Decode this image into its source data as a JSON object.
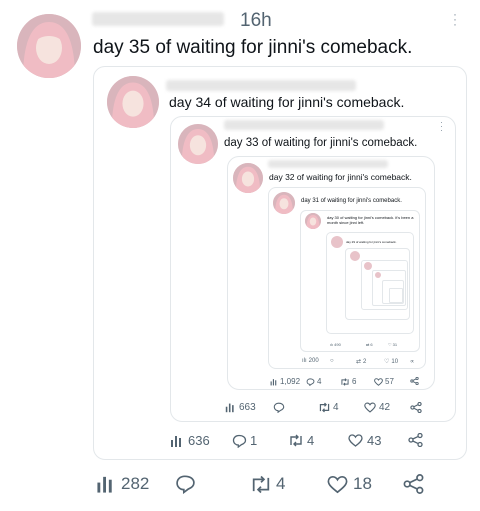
{
  "colors": {
    "text": "#0f1419",
    "muted": "#536471",
    "border": "#e3e7ea",
    "avatar_hair": "#f0bcc4",
    "avatar_skin": "#f6e3de"
  },
  "post": {
    "time": "16h",
    "text": "day 35 of waiting for jinni's comeback.",
    "actions": {
      "views": "282",
      "reposts": "4",
      "likes": "18"
    }
  },
  "quote1": {
    "text": "day 34 of waiting for jinni's comeback.",
    "actions": {
      "views": "636",
      "replies": "1",
      "reposts": "4",
      "likes": "43"
    }
  },
  "quote2": {
    "text": "day 33 of waiting for jinni's comeback.",
    "actions": {
      "views": "663",
      "reposts": "4",
      "likes": "42"
    }
  },
  "quote3": {
    "text": "day 32 of waiting for jinni's comeback.",
    "actions": {
      "views": "1,092",
      "replies": "4",
      "reposts": "6",
      "likes": "57"
    }
  },
  "quote4": {
    "text": "day 31 of waiting for jinni's comeback.",
    "actions": {
      "views": "200",
      "reposts": "2",
      "likes": "10"
    }
  },
  "quote5": {
    "text": "day 30 of waiting for jinni's comeback. it's been a month since jinni left.",
    "actions": {
      "views": "490",
      "reposts": "6",
      "likes": "31"
    }
  },
  "quote6": {
    "text": "day 29 of waiting for jinni's comeback."
  }
}
